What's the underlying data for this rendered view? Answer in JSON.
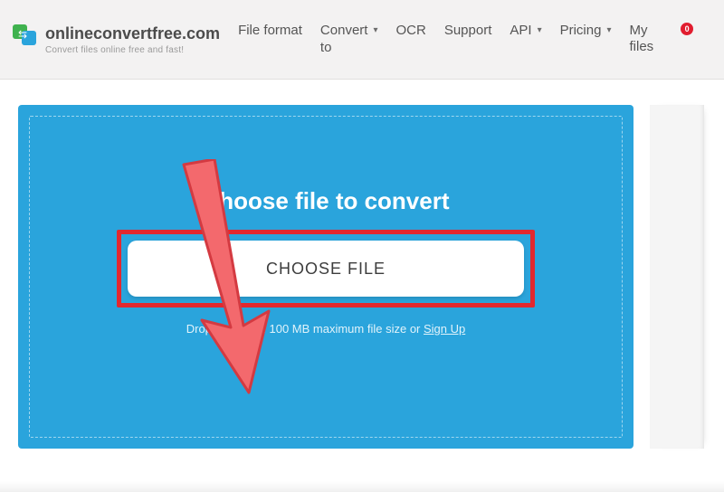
{
  "brand": {
    "name": "onlineconvertfree.com",
    "tagline": "Convert files online free and fast!"
  },
  "nav": {
    "file_format": "File format",
    "convert_to": {
      "line1": "Convert",
      "line2": "to"
    },
    "ocr": "OCR",
    "support": "Support",
    "api": "API",
    "pricing": "Pricing",
    "my_files": {
      "line1": "My",
      "line2": "files"
    },
    "badge": "0"
  },
  "upload": {
    "title": "Choose file to convert",
    "button": "CHOOSE FILE",
    "hint_prefix": "Drop files here. 100 MB maximum file size or ",
    "hint_link": "Sign Up"
  },
  "colors": {
    "panel": "#2aa4dc",
    "highlight": "#e2282f",
    "arrow_fill": "#f3696d",
    "arrow_stroke": "#d43a41"
  }
}
